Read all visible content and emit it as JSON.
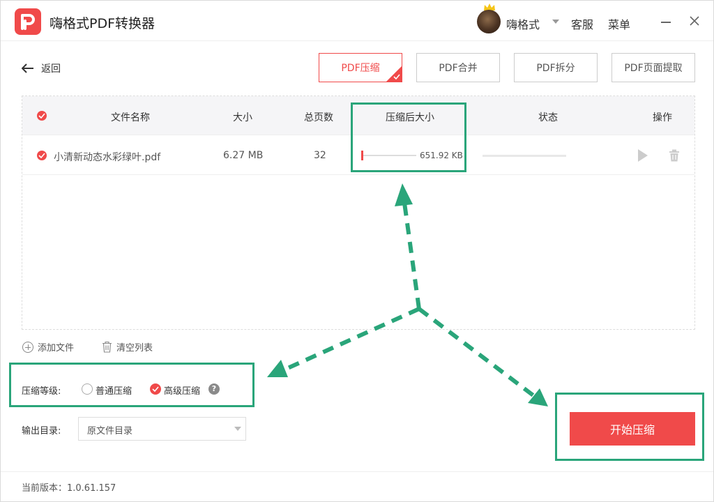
{
  "titlebar": {
    "app_title": "嗨格式PDF转换器",
    "username": "嗨格式",
    "service": "客服",
    "menu": "菜单"
  },
  "nav": {
    "back_label": "返回",
    "tabs": [
      {
        "label": "PDF压缩",
        "active": true
      },
      {
        "label": "PDF合并",
        "active": false
      },
      {
        "label": "PDF拆分",
        "active": false
      },
      {
        "label": "PDF页面提取",
        "active": false
      }
    ]
  },
  "table": {
    "headers": {
      "name": "文件名称",
      "size": "大小",
      "pages": "总页数",
      "compressed_size": "压缩后大小",
      "status": "状态",
      "actions": "操作"
    },
    "rows": [
      {
        "name": "小清新动态水彩绿叶.pdf",
        "size": "6.27 MB",
        "pages": "32",
        "compressed_size": "651.92 KB"
      }
    ]
  },
  "list_actions": {
    "add_file": "添加文件",
    "clear_list": "清空列表"
  },
  "compression": {
    "label": "压缩等级:",
    "options": [
      {
        "label": "普通压缩",
        "checked": false
      },
      {
        "label": "高级压缩",
        "checked": true
      }
    ],
    "help": "?"
  },
  "output": {
    "label": "输出目录:",
    "value": "原文件目录"
  },
  "start_button": "开始压缩",
  "footer": {
    "version": "当前版本：1.0.61.157"
  },
  "colors": {
    "accent": "#f04a4a",
    "annotation": "#2aa57a"
  }
}
